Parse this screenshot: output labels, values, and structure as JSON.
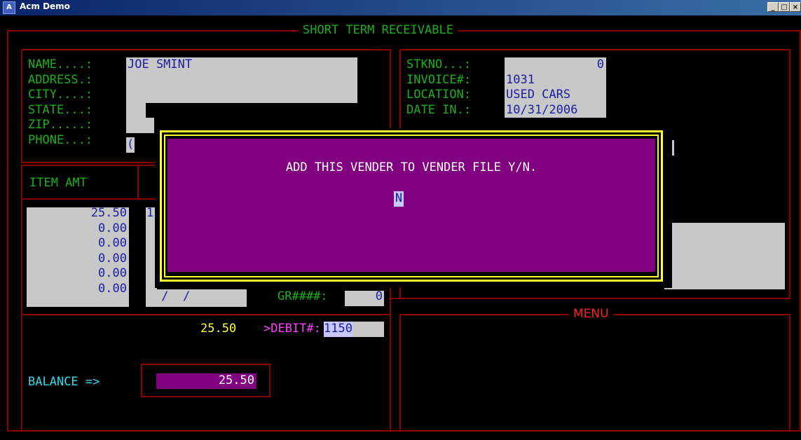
{
  "window": {
    "title": "Acm Demo",
    "min": "_",
    "max": "□",
    "close": "×"
  },
  "screen": {
    "title": "SHORT TERM RECEIVABLE",
    "customer": {
      "name_label": "NAME....:",
      "name_value": "JOE SMINT",
      "address_label": "ADDRESS.:",
      "city_label": "CITY....:",
      "state_label": "STATE...:",
      "zip_label": "ZIP.....:",
      "phone_label": "PHONE...:",
      "phone_value": "("
    },
    "stock": {
      "stkno_label": "STKNO...:",
      "stkno_value": "0",
      "invoice_label": "INVOICE#:",
      "invoice_value": "1031",
      "location_label": "LOCATION:",
      "location_value": "USED CARS",
      "datein_label": "DATE IN.:",
      "datein_value": "10/31/2006"
    },
    "items": {
      "header": "ITEM AMT",
      "amounts": [
        "25.50",
        "0.00",
        "0.00",
        "0.00",
        "0.00",
        "0.00"
      ],
      "first_code": "1",
      "date_value": " /  /",
      "gr_label": "GR####:",
      "gr_value": "0"
    },
    "totals": {
      "total_value": "25.50",
      "debit_label": ">DEBIT#:",
      "debit_value": "1150",
      "balance_label": "BALANCE =>",
      "balance_value": "25.50"
    },
    "menu": {
      "title": "MENU"
    },
    "dialog": {
      "message": "ADD THIS VENDER TO VENDER FILE Y/N.",
      "answer": "N"
    }
  }
}
